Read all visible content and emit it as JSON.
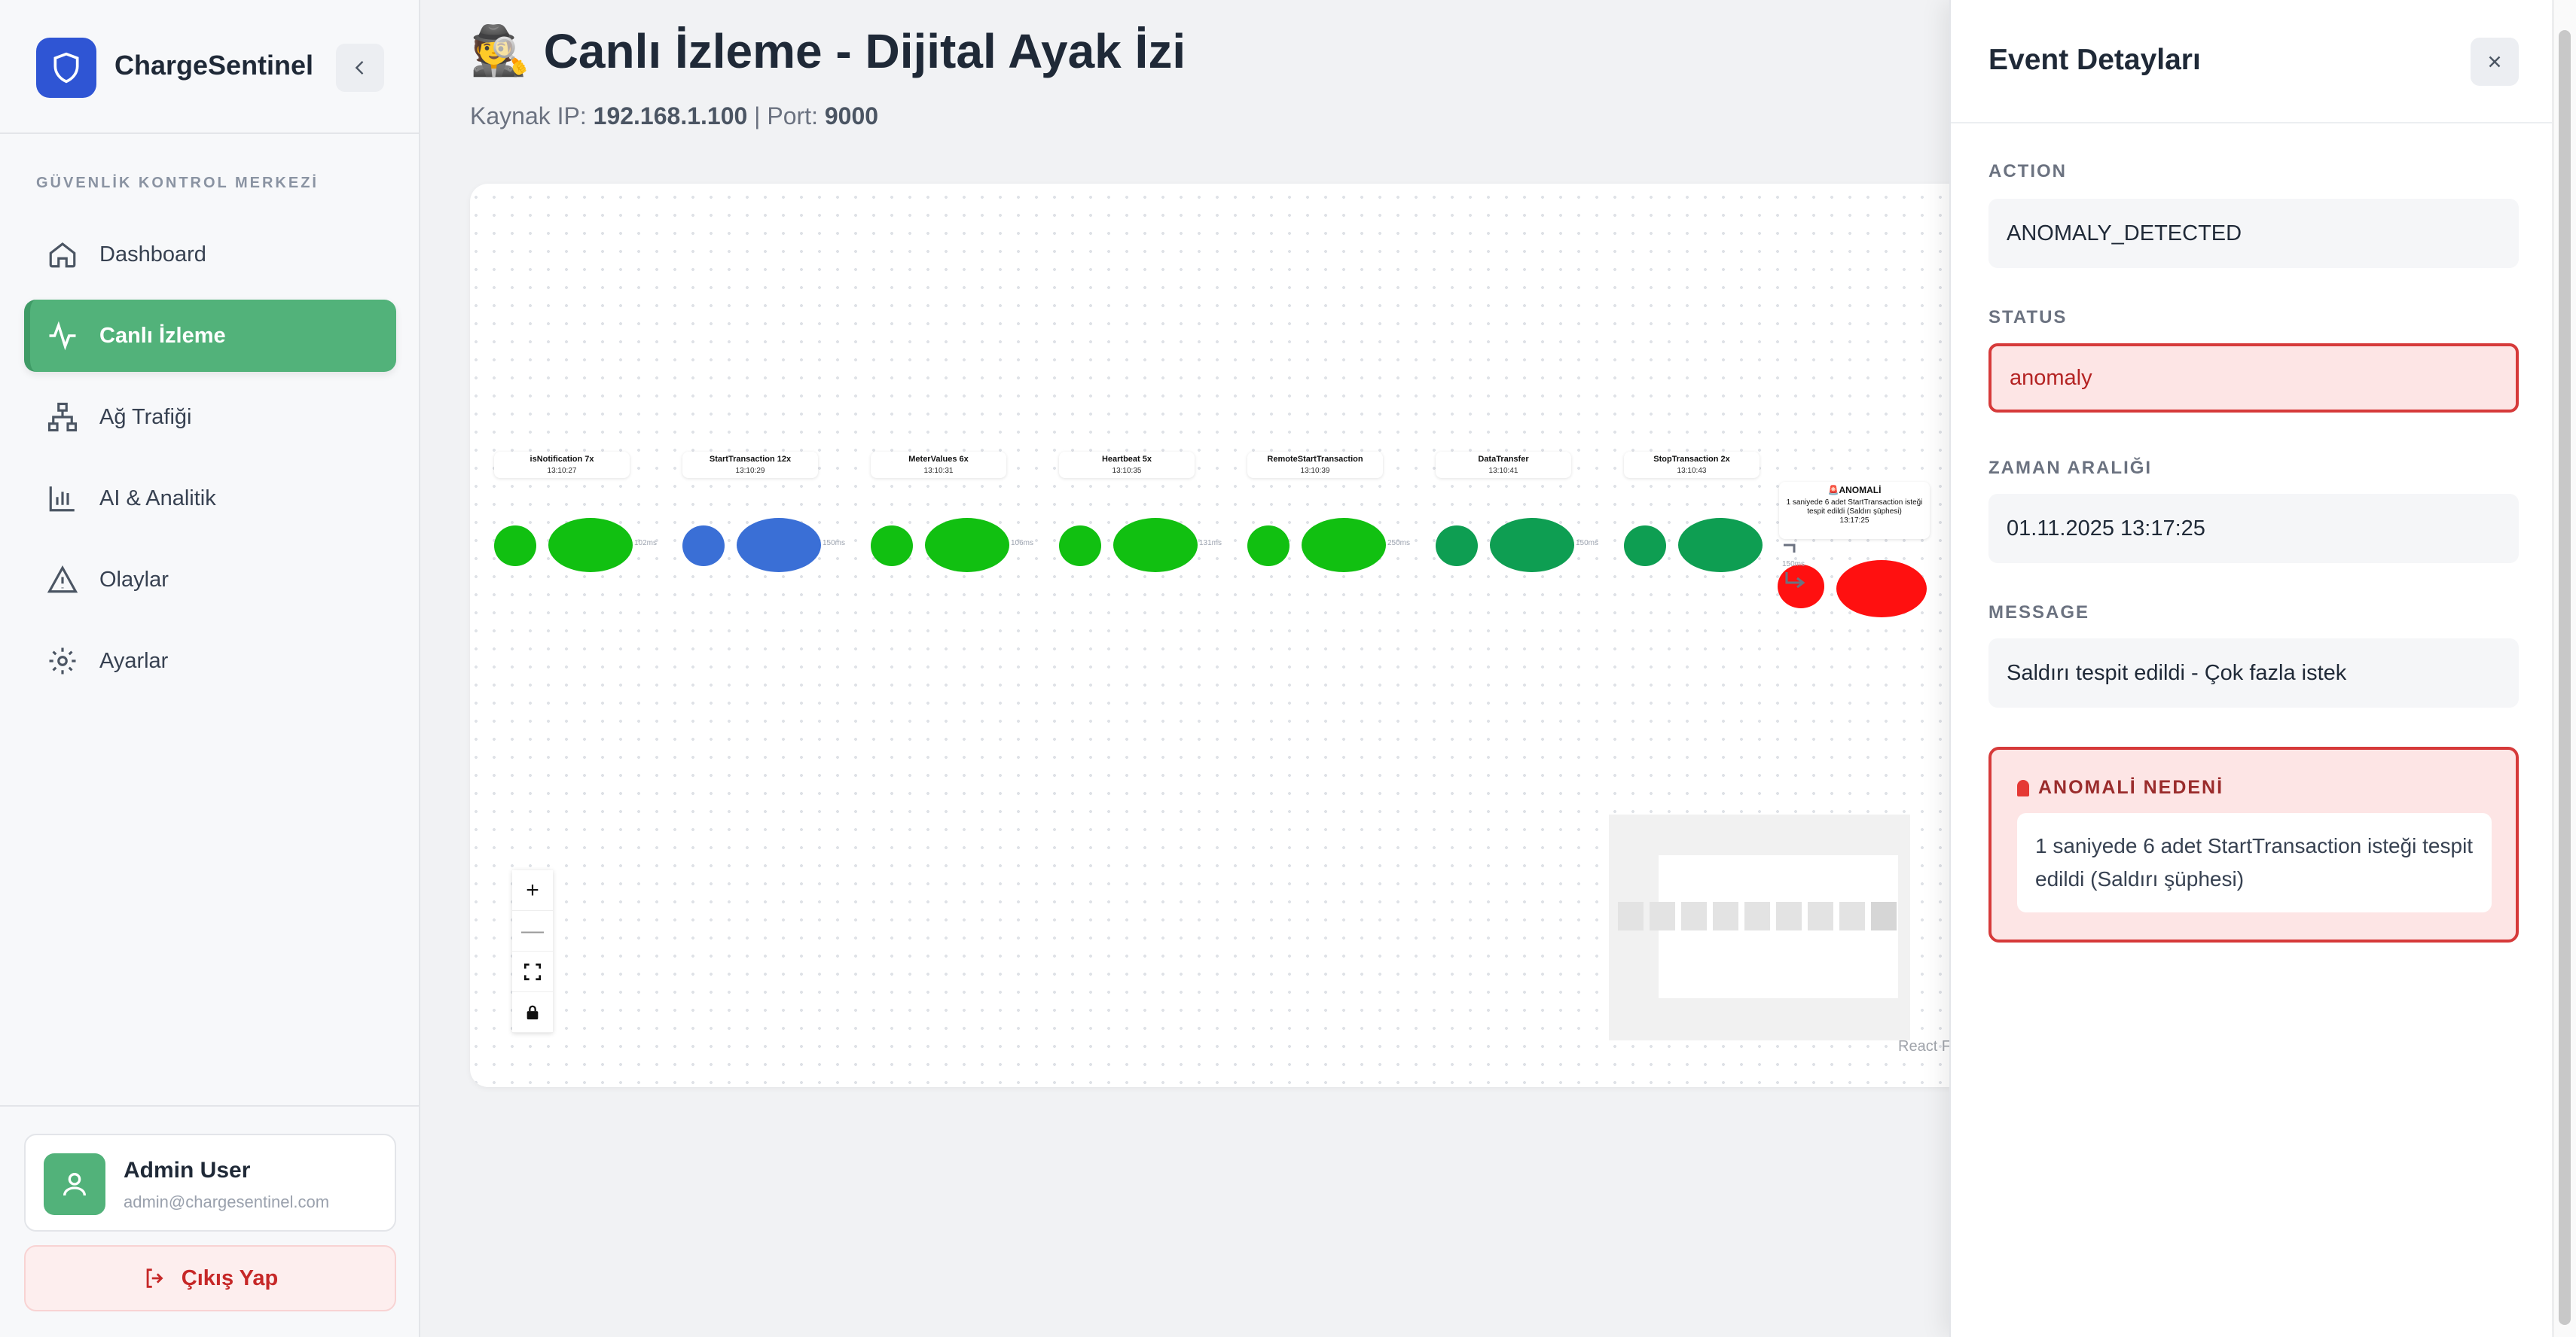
{
  "sidebar": {
    "brand": "ChargeSentinel",
    "section_title": "GÜVENLİK KONTROL MERKEZİ",
    "items": [
      {
        "label": "Dashboard",
        "icon": "home-icon"
      },
      {
        "label": "Canlı İzleme",
        "icon": "activity-icon",
        "active": true
      },
      {
        "label": "Ağ Trafiği",
        "icon": "network-icon"
      },
      {
        "label": "AI & Analitik",
        "icon": "bar-chart-icon"
      },
      {
        "label": "Olaylar",
        "icon": "alert-triangle-icon"
      },
      {
        "label": "Ayarlar",
        "icon": "gear-icon"
      }
    ],
    "user": {
      "name": "Admin User",
      "email": "admin@chargesentinel.com"
    },
    "logout_label": "Çıkış Yap"
  },
  "main": {
    "title": "Canlı İzleme - Dijital Ayak İzi",
    "title_icon": "🕵️",
    "source_prefix": "Kaynak IP:",
    "ip": "192.168.1.100",
    "port_prefix": "| Port:",
    "port": "9000"
  },
  "flow": {
    "nodes": [
      {
        "label": "isNotification",
        "count": "7x",
        "time": "13:10:27",
        "color": "#11c011"
      },
      {
        "label": "StartTransaction",
        "count": "12x",
        "time": "13:10:29",
        "color": "#3a6fd6"
      },
      {
        "label": "MeterValues",
        "count": "6x",
        "time": "13:10:31",
        "color": "#11c011"
      },
      {
        "label": "Heartbeat",
        "count": "5x",
        "time": "13:10:35",
        "color": "#11c011"
      },
      {
        "label": "RemoteStartTransaction",
        "count": "",
        "time": "13:10:39",
        "color": "#11c011"
      },
      {
        "label": "DataTransfer",
        "count": "",
        "time": "13:10:41",
        "color": "#0e9e52"
      },
      {
        "label": "StopTransaction",
        "count": "2x",
        "time": "13:10:43",
        "color": "#0e9e52"
      }
    ],
    "edges": [
      "102ms",
      "150ms",
      "106ms",
      "131ms",
      "250ms",
      "150ms",
      "150ms"
    ],
    "anomaly": {
      "title": "🚨ANOMALİ",
      "text": "1 saniyede 6 adet StartTransaction isteği tespit edildi (Saldırı şüphesi)",
      "time": "13:17:25",
      "color": "#ff1010"
    },
    "attribution": "React Flow"
  },
  "drawer": {
    "title": "Event Detayları",
    "fields": [
      {
        "label": "ACTION",
        "value": "ANOMALY_DETECTED"
      },
      {
        "label": "STATUS",
        "value": "anomaly"
      },
      {
        "label": "ZAMAN ARALIĞI",
        "value": "01.11.2025 13:17:25"
      },
      {
        "label": "MESSAGE",
        "value": "Saldırı tespit edildi - Çok fazla istek"
      }
    ],
    "reason_title": "ANOMALİ NEDENİ",
    "reason_text": "1 saniyede 6 adet StartTransaction isteği tespit edildi (Saldırı şüphesi)"
  }
}
